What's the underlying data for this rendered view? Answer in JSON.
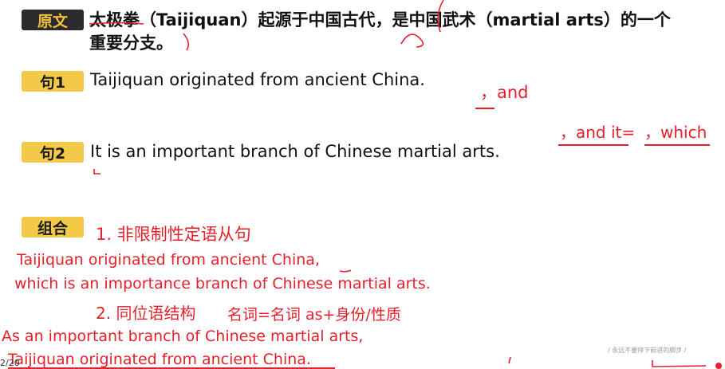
{
  "header": {
    "tag": "原文",
    "text_line1": "太极拳（Taijiquan）起源于中国古代，是中国武术（martial arts）的一个",
    "text_line2": "重要分支。"
  },
  "sentence1": {
    "tag": "句1",
    "text": "Taijiquan originated from ancient China."
  },
  "sentence2": {
    "tag": "句2",
    "text": "It is an important branch of Chinese martial arts."
  },
  "combine": {
    "tag": "组合"
  },
  "annotations": {
    "comma_and": "，and",
    "comma_and_it": "，and it=",
    "comma_which": "，which",
    "method1_title": "1. 非限制性定语从句",
    "method1_line1": "Taijiquan originated from ancient China,",
    "method1_line2": "which is an importance branch of Chinese martial arts.",
    "method2_title": "2. 同位语结构",
    "method2_note": "名词=名词  as+身份/性质",
    "method2_line1": "As an important branch of Chinese martial arts,",
    "method2_line2": "Taijiquan originated from ancient China."
  },
  "footer": {
    "page": "2/20",
    "watermark": "/ 永远不要停下前进的脚步 /"
  },
  "colors": {
    "ink_red": "#e5202a",
    "tag_dark": "#2b2b2b",
    "tag_yellow": "#f3c94a",
    "tag_dark_text": "#f3c33b"
  }
}
